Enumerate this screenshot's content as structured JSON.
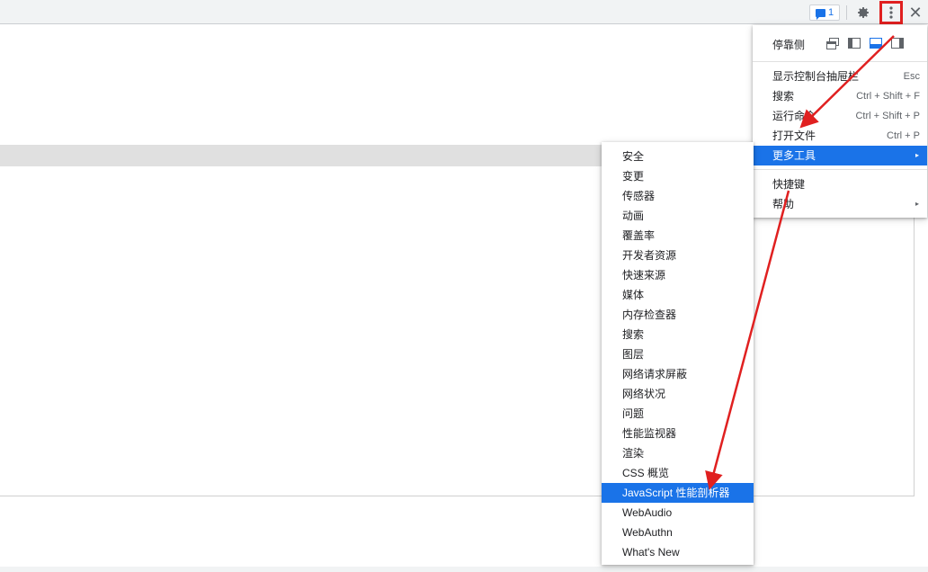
{
  "toolbar": {
    "issues_count": "1",
    "gear_icon": "gear-icon",
    "kebab_icon": "three-dots-vertical-icon",
    "close_label": "✕"
  },
  "main_menu": {
    "dock_label": "停靠侧",
    "dock_options": [
      "undock-icon",
      "dock-left-icon",
      "dock-bottom-icon",
      "dock-right-icon"
    ],
    "items": [
      {
        "label": "显示控制台抽屉栏",
        "shortcut": "Esc"
      },
      {
        "label": "搜索",
        "shortcut": "Ctrl + Shift + F"
      },
      {
        "label": "运行命令",
        "shortcut": "Ctrl + Shift + P"
      },
      {
        "label": "打开文件",
        "shortcut": "Ctrl + P"
      },
      {
        "label": "更多工具",
        "shortcut": "▸"
      },
      {
        "label": "快捷键",
        "shortcut": ""
      },
      {
        "label": "帮助",
        "shortcut": "▸"
      }
    ]
  },
  "sub_menu": {
    "items": [
      "安全",
      "变更",
      "传感器",
      "动画",
      "覆盖率",
      "开发者资源",
      "快速来源",
      "媒体",
      "内存检查器",
      "搜索",
      "图层",
      "网络请求屏蔽",
      "网络状况",
      "问题",
      "性能监视器",
      "渲染",
      "CSS 概览",
      "JavaScript 性能剖析器",
      "WebAudio",
      "WebAuthn",
      "What's New"
    ],
    "selected_index": 17
  },
  "colors": {
    "accent": "#1a73e8",
    "annotation": "#e02020"
  }
}
